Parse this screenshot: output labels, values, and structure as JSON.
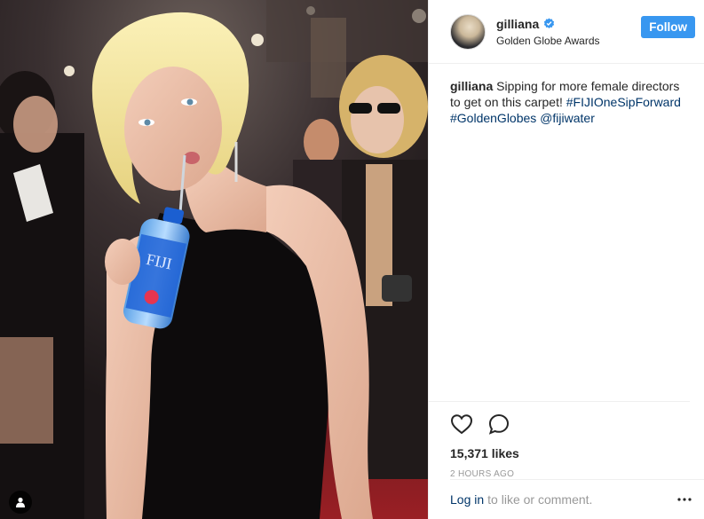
{
  "post": {
    "username": "gilliana",
    "location": "Golden Globe Awards",
    "follow_label": "Follow",
    "caption": {
      "username": "gilliana",
      "text": "Sipping for more female directors to get on this carpet!",
      "hashtag_1": "#FIJIOneSipForward",
      "hashtag_2": "#GoldenGlobes",
      "mention": "@fijiwater"
    },
    "likes": "15,371 likes",
    "time": "2 HOURS AGO",
    "login_link": "Log in",
    "login_suffix": "to like or comment."
  },
  "photo": {
    "bottle_label": "FIJI"
  },
  "icons": {
    "verified": "verified-badge-icon",
    "like": "heart-icon",
    "comment": "comment-icon",
    "more": "more-options-icon",
    "user_tag": "user-tag-icon"
  },
  "colors": {
    "follow_button": "#3897f0",
    "link": "#003569",
    "muted": "#999999",
    "border": "#efefef"
  }
}
